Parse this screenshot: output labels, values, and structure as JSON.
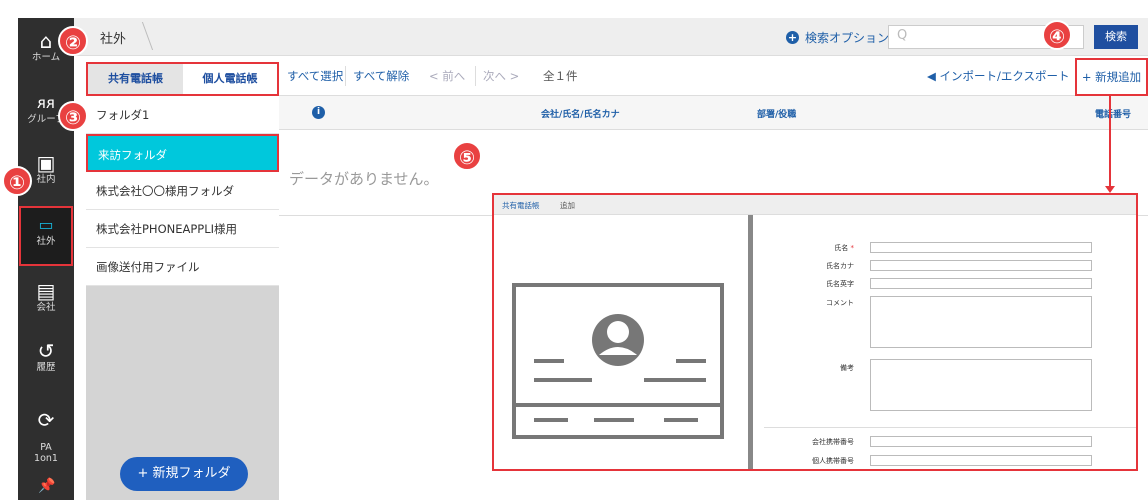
{
  "nav": {
    "items": [
      {
        "label": "ホーム",
        "icon": "home-icon"
      },
      {
        "label": "グループ",
        "icon": "group-icon"
      },
      {
        "label": "社内",
        "icon": "internal-contact-icon"
      },
      {
        "label": "社外",
        "icon": "external-card-icon"
      },
      {
        "label": "会社",
        "icon": "company-building-icon"
      },
      {
        "label": "履歴",
        "icon": "history-icon"
      },
      {
        "label": "PA\n1on1",
        "icon": "pa-1on1-icon"
      }
    ]
  },
  "header": {
    "breadcrumb": "社外",
    "search_option": "検索オプション",
    "search_placeholder": "Q",
    "search_button": "検索"
  },
  "tabs": {
    "shared": "共有電話帳",
    "personal": "個人電話帳"
  },
  "folders": {
    "items": [
      "フォルダ1",
      "来訪フォルダ",
      "株式会社〇〇様用フォルダ",
      "株式会社PHONEAPPLI様用",
      "画像送付用ファイル"
    ],
    "new_folder": "+ 新規フォルダ"
  },
  "toolbar": {
    "select_all": "すべて選択",
    "deselect_all": "すべて解除",
    "prev": "< 前へ",
    "next": "次へ >",
    "count": "全１件",
    "import_export": "インポート/エクスポート",
    "add_new": "+ 新規追加"
  },
  "table": {
    "columns": [
      "会社/氏名/氏名カナ",
      "部署/役職",
      "電話番号"
    ],
    "empty": "データがありません。"
  },
  "preview": {
    "crumb_shared": "共有電話帳",
    "crumb_add": "追加",
    "fields": [
      "氏名",
      "氏名カナ",
      "氏名英字",
      "コメント",
      "備考",
      "会社携帯番号",
      "個人携帯番号"
    ],
    "required_mark": "*"
  },
  "callouts": [
    "①",
    "②",
    "③",
    "④",
    "⑤"
  ],
  "colors": {
    "accent": "#1f5fa8",
    "active_folder": "#00c8dc",
    "highlight": "#e5343a",
    "nav_bg": "#2f2f2f"
  }
}
